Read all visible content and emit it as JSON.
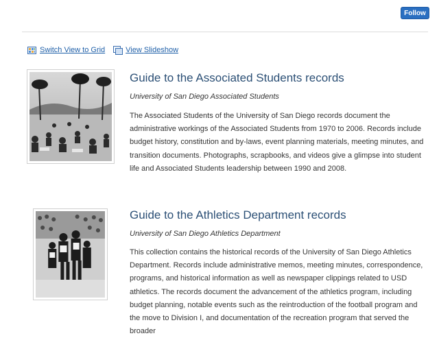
{
  "header": {
    "follow_label": "Follow"
  },
  "view_options": {
    "grid_label": "Switch View to Grid",
    "slideshow_label": "View Slideshow",
    "grid_icon": "grid-view-icon",
    "slideshow_icon": "slideshow-icon"
  },
  "items": [
    {
      "title": "Guide to the Associated Students records",
      "subtitle": "University of San Diego Associated Students",
      "description": "The Associated Students of the University of San Diego records document the administrative workings of the Associated Students from 1970 to 2006. Records include budget history, constitution and by-laws, event planning materials, meeting minutes, and transition documents. Photographs, scrapbooks, and videos give a glimpse into student life and Associated Students leadership between 1990 and 2008."
    },
    {
      "title": "Guide to the Athletics Department records",
      "subtitle": "University of San Diego Athletics Department",
      "description": "This collection contains the historical records of the University of San Diego Athletics Department. Records include administrative memos, meeting minutes, correspondence, programs, and historical information as well as newspaper clippings related to USD athletics. The records document the advancement of the athletics program, including budget planning, notable events such as the reintroduction of the football program and the move to Division I, and documentation of the recreation program that served the broader"
    }
  ],
  "colors": {
    "accent": "#2a6fc1",
    "title": "#2b4f75",
    "link": "#1e5fa8"
  }
}
